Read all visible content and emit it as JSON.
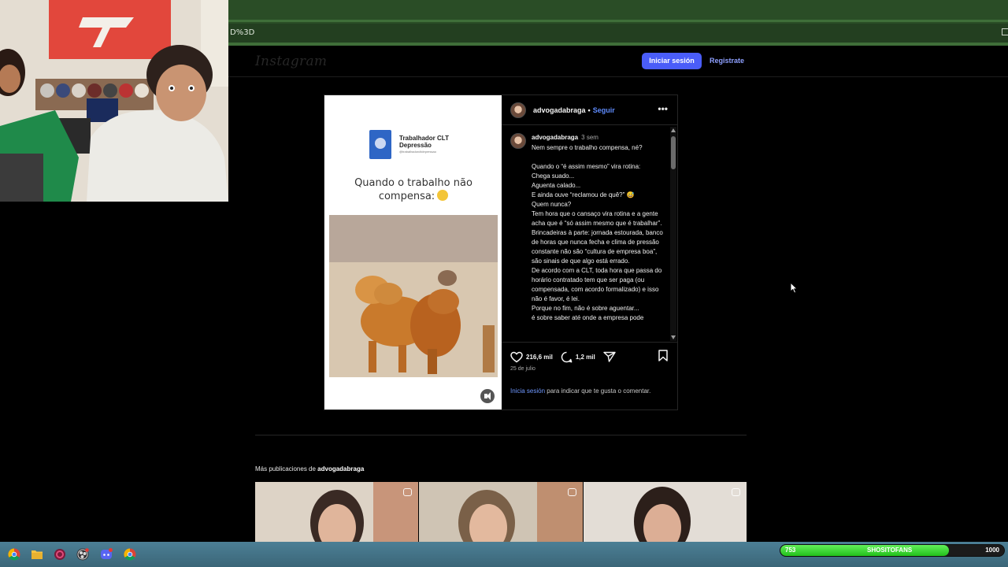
{
  "browser": {
    "address_fragment": "D%3D"
  },
  "instagram": {
    "logo": "Instagram",
    "login_button": "Iniciar sesión",
    "register_button": "Registrate"
  },
  "post": {
    "media": {
      "doc_title": "Trabalhador CLT Depressão",
      "doc_handle": "@trabalhadorcltdepressao",
      "headline": "Quando o trabalho não compensa:"
    },
    "author": "advogadabraga",
    "separator": "•",
    "follow_label": "Seguir",
    "more_icon": "more-horizontal-icon",
    "caption_author": "advogadabraga",
    "caption_time": "3 sem",
    "caption_text": "Nem sempre o trabalho compensa, né?\n\nQuando o “é assim mesmo” vira rotina:\nChega suado...\nAguenta calado...\nE ainda ouve “reclamou de quê?” 😅\nQuem nunca?\nTem hora que o cansaço vira rotina e a gente acha que é “só assim mesmo que é trabalhar”.\nBrincadeiras à parte: jornada estourada, banco de horas que nunca fecha e clima de pressão constante não são “cultura de empresa boa”, são sinais de que algo está errado.\nDe acordo com a CLT, toda hora que passa do horário contratado tem que ser paga (ou compensada, com acordo formalizado) e isso não é favor, é lei.\nPorque no fim, não é sobre aguentar...\né sobre saber até onde a empresa pode",
    "likes": "216,6 mil",
    "comments": "1,2 mil",
    "date": "25 de julio",
    "login_hint_link": "Inicia sesión",
    "login_hint_rest": " para indicar que te gusta o comentar."
  },
  "more_posts": {
    "prefix": "Más publicaciones de ",
    "author": "advogadabraga"
  },
  "sub_goal": {
    "current": "753",
    "name": "SHOSITOFANS",
    "target": "1000",
    "progress": 0.753
  },
  "colors": {
    "accent": "#4a5df9",
    "link": "#6f98ff",
    "browser_green": "#2a4d26",
    "taskbar": "#3b6678"
  }
}
